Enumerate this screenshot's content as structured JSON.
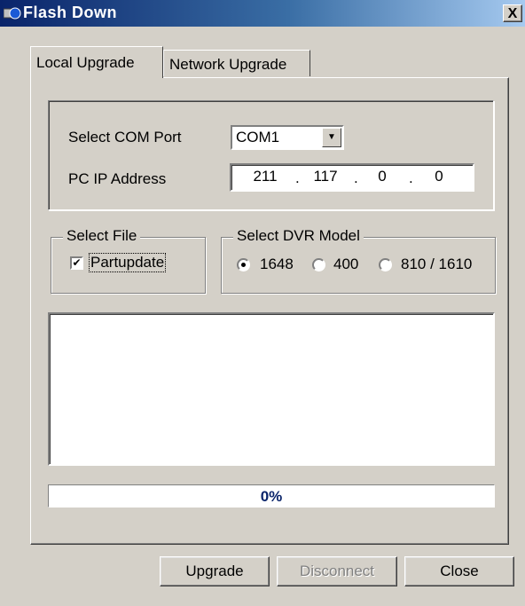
{
  "window": {
    "title": "Flash Down",
    "close_glyph": "X"
  },
  "tabs": [
    {
      "label": "Local Upgrade",
      "active": true
    },
    {
      "label": "Network Upgrade",
      "active": false
    }
  ],
  "com": {
    "label": "Select COM Port",
    "value": "COM1"
  },
  "ip": {
    "label": "PC IP Address",
    "octets": [
      "211",
      "117",
      "0",
      "0"
    ],
    "separator": "."
  },
  "select_file": {
    "legend": "Select File",
    "checkbox_label": "Partupdate",
    "checked": true
  },
  "dvr_model": {
    "legend": "Select DVR Model",
    "options": [
      {
        "label": "1648",
        "selected": true
      },
      {
        "label": "400",
        "selected": false
      },
      {
        "label": "810 / 1610",
        "selected": false
      }
    ]
  },
  "log": {
    "text": ""
  },
  "progress": {
    "text": "0%",
    "value": 0
  },
  "buttons": {
    "upgrade": "Upgrade",
    "disconnect": "Disconnect",
    "close": "Close"
  },
  "colors": {
    "face": "#d4d0c8",
    "title_start": "#0a246a",
    "title_end": "#a6caf0",
    "progress_text": "#0a246a"
  }
}
